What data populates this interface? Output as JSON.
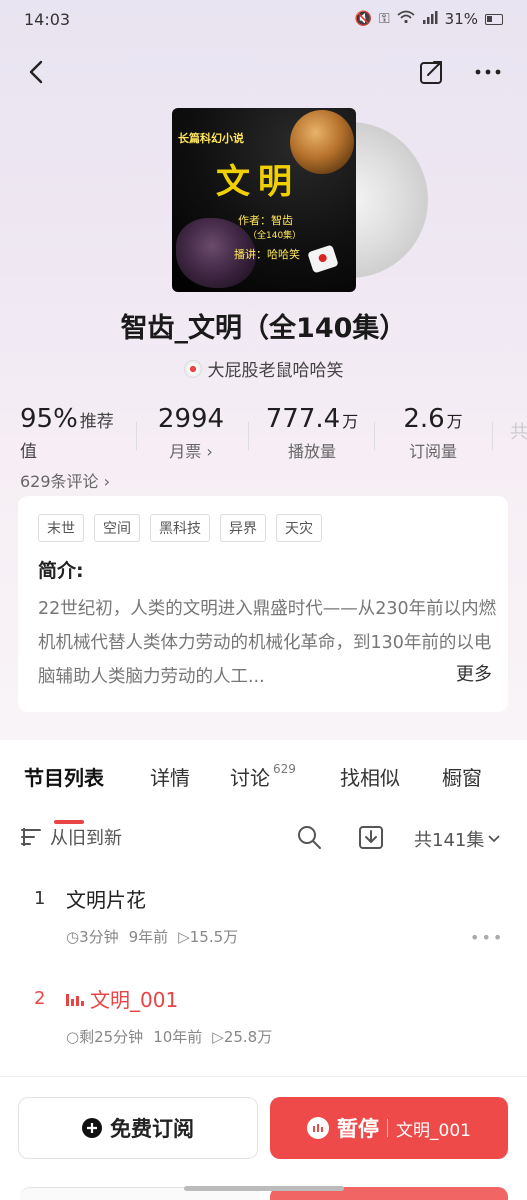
{
  "status": {
    "time": "14:03",
    "battery": "31%"
  },
  "cover": {
    "tag": "长篇科幻小说",
    "title": "文明",
    "author": "作者：智齿",
    "count": "（全140集）",
    "reader": "播讲：哈哈笑"
  },
  "album": {
    "title": "智齿_文明（全140集）",
    "anchor": "大屁股老鼠哈哈笑"
  },
  "stats": [
    {
      "value": "95%",
      "unit": "",
      "suffix": "推荐值",
      "label": "629条评论 ›"
    },
    {
      "value": "2994",
      "unit": "",
      "suffix": "",
      "label": "月票 ›"
    },
    {
      "value": "777.4",
      "unit": "万",
      "suffix": "",
      "label": "播放量"
    },
    {
      "value": "2.6",
      "unit": "万",
      "suffix": "",
      "label": "订阅量"
    }
  ],
  "intro": {
    "tags": [
      "末世",
      "空间",
      "黑科技",
      "异界",
      "天灾"
    ],
    "heading": "简介:",
    "text": "22世纪初，人类的文明进入鼎盛时代——从230年前以内燃机机械代替人类体力劳动的机械化革命，到130年前的以电脑辅助人类脑力劳动的人工...",
    "more": "更多"
  },
  "tabs": [
    {
      "label": "节目列表",
      "badge": ""
    },
    {
      "label": "详情",
      "badge": ""
    },
    {
      "label": "讨论",
      "badge": "629"
    },
    {
      "label": "找相似",
      "badge": ""
    },
    {
      "label": "橱窗",
      "badge": ""
    }
  ],
  "sort": {
    "label": "从旧到新",
    "count": "共141集"
  },
  "episodes": [
    {
      "num": "1",
      "title": "文明片花",
      "duration": "3分钟",
      "age": "9年前",
      "plays": "15.5万"
    },
    {
      "num": "2",
      "title": "文明_001",
      "duration": "剩25分钟",
      "age": "10年前",
      "plays": "25.8万"
    }
  ],
  "bottom": {
    "subscribe": "免费订阅",
    "play": "暂停",
    "current": "文明_001"
  },
  "colors": {
    "accent": "#ef4a4a"
  }
}
